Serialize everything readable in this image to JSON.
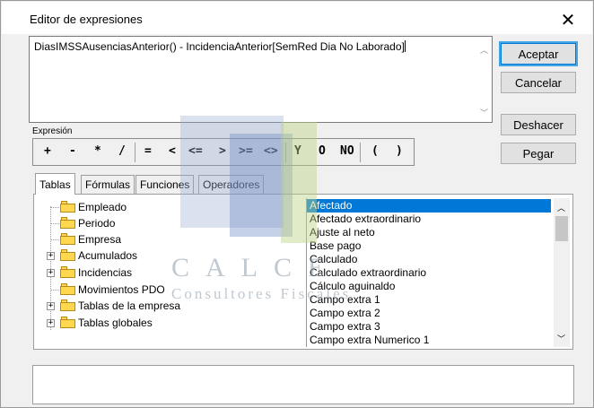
{
  "dialog": {
    "title": "Editor de expresiones",
    "close_glyph": "✕"
  },
  "editor": {
    "value": "DiasIMSSAusenciasAnterior() - IncidenciaAnterior[SemRed Dia No Laborado]"
  },
  "buttons": {
    "accept": "Aceptar",
    "cancel": "Cancelar",
    "undo": "Deshacer",
    "paste": "Pegar"
  },
  "expression_label": "Expresión",
  "operators": [
    "+",
    "-",
    "*",
    "/",
    "=",
    "<",
    "<=",
    ">",
    ">=",
    "<>",
    "Y",
    "O",
    "NO",
    "(",
    ")"
  ],
  "tabs": [
    {
      "label": "Tablas",
      "active": true
    },
    {
      "label": "Fórmulas",
      "active": false
    },
    {
      "label": "Funciones",
      "active": false
    },
    {
      "label": "Operadores",
      "active": false
    }
  ],
  "tree": [
    {
      "label": "Empleado",
      "expandable": false
    },
    {
      "label": "Periodo",
      "expandable": false
    },
    {
      "label": "Empresa",
      "expandable": false
    },
    {
      "label": "Acumulados",
      "expandable": true
    },
    {
      "label": "Incidencias",
      "expandable": true
    },
    {
      "label": "Movimientos PDO",
      "expandable": false
    },
    {
      "label": "Tablas de la empresa",
      "expandable": true
    },
    {
      "label": "Tablas globales",
      "expandable": true
    }
  ],
  "fields": [
    "Afectado",
    "Afectado extraordinario",
    "Ajuste al neto",
    "Base pago",
    "Calculado",
    "Calculado extraordinario",
    "Cálculo aguinaldo",
    "Campo extra 1",
    "Campo extra 2",
    "Campo extra 3",
    "Campo extra Numerico 1"
  ],
  "selected_field": "Afectado",
  "watermark": {
    "brand": "CALCE",
    "tagline": "Consultores Fiscales"
  },
  "colors": {
    "selection": "#0078d7",
    "default_button_border": "#40a6e4",
    "folder": "#ffd84f"
  },
  "icons": {
    "close": "close-icon",
    "folder": "folder-icon",
    "expand": "plus-expander-icon",
    "scroll_up": "chevron-up-icon",
    "scroll_down": "chevron-down-icon"
  }
}
